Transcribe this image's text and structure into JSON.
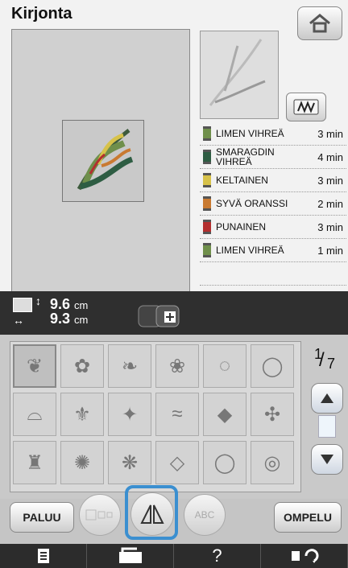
{
  "header": {
    "title": "Kirjonta"
  },
  "icons": {
    "home": "home-icon",
    "pattern": "pattern-icon"
  },
  "threads": [
    {
      "name": "LIMEN VIHREÄ",
      "time": "3 min",
      "color": "#6f8f4b"
    },
    {
      "name": "SMARAGDIN\nVIHREÄ",
      "time": "4 min",
      "color": "#2e5d43"
    },
    {
      "name": "KELTAINEN",
      "time": "3 min",
      "color": "#d7c24a"
    },
    {
      "name": "SYVÄ ORANSSI",
      "time": "2 min",
      "color": "#c97a31"
    },
    {
      "name": "PUNAINEN",
      "time": "3 min",
      "color": "#b32f2f"
    },
    {
      "name": "LIMEN VIHREÄ",
      "time": "1 min",
      "color": "#6f8f4b"
    }
  ],
  "size": {
    "height": "9.6",
    "height_unit": "cm",
    "width": "9.3",
    "width_unit": "cm"
  },
  "pager": {
    "current": "1",
    "total": "7"
  },
  "grid_items": [
    "leaf-bouquet-design",
    "flower-design",
    "branch-design",
    "bird-design",
    "wreath-small-design",
    "wreath-design",
    "arch-design",
    "fleur-design",
    "ornament-design",
    "border-design",
    "diamond-ornament-design",
    "scroll-design",
    "vase-design",
    "rosette-design",
    "medallion-design",
    "small-diamond-design",
    "laurel-wreath-design",
    "circle-frame-design"
  ],
  "buttons": {
    "back": "PALUU",
    "abc": "ABC",
    "sew": "OMPELU"
  },
  "footer": [
    "document-icon",
    "machine-icon",
    "help-icon",
    "settings-icon"
  ],
  "footer_help": "?"
}
